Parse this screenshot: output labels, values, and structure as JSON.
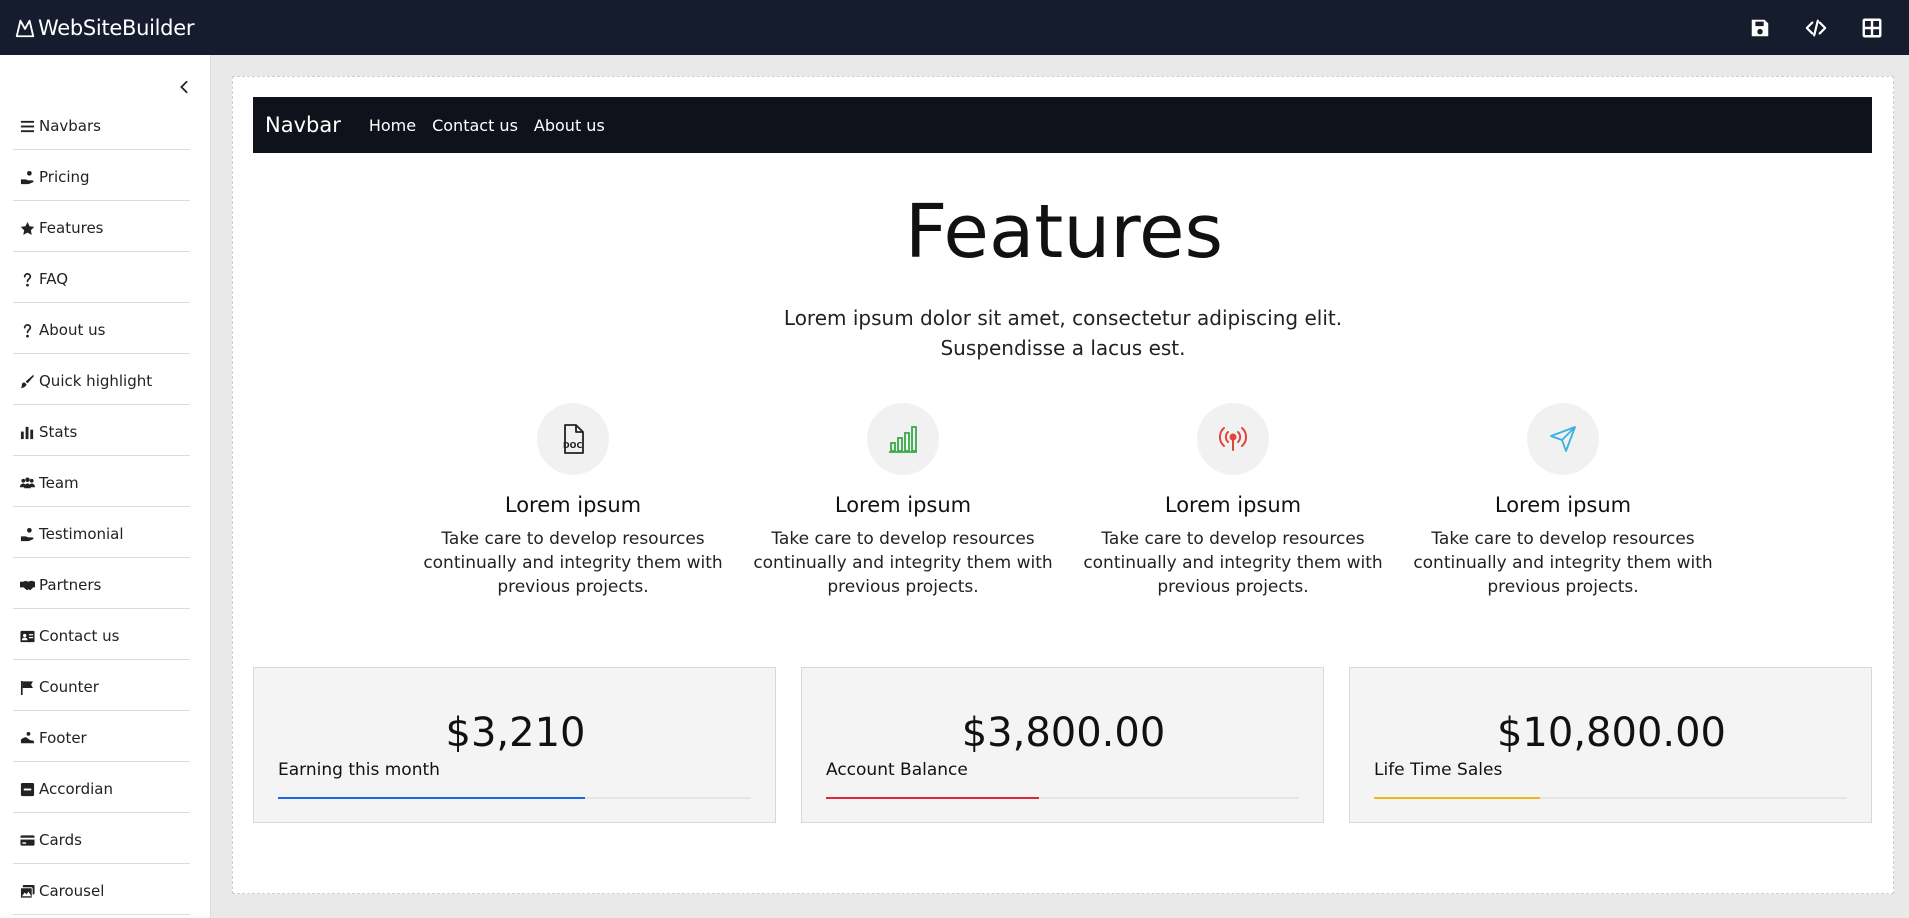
{
  "app": {
    "name": "WebSiteBuilder"
  },
  "toolbar": {
    "icons": [
      "save-icon",
      "code-icon",
      "grid-icon"
    ]
  },
  "sidebar": {
    "items": [
      {
        "label": "Navbars",
        "icon": "bars-icon"
      },
      {
        "label": "Pricing",
        "icon": "hand-coin-icon"
      },
      {
        "label": "Features",
        "icon": "star-icon"
      },
      {
        "label": "FAQ",
        "icon": "question-icon"
      },
      {
        "label": "About us",
        "icon": "question-icon"
      },
      {
        "label": "Quick highlight",
        "icon": "brush-icon"
      },
      {
        "label": "Stats",
        "icon": "bar-chart-icon"
      },
      {
        "label": "Team",
        "icon": "users-icon"
      },
      {
        "label": "Testimonial",
        "icon": "hand-coin-icon"
      },
      {
        "label": "Partners",
        "icon": "handshake-icon"
      },
      {
        "label": "Contact us",
        "icon": "id-card-icon"
      },
      {
        "label": "Counter",
        "icon": "flag-icon"
      },
      {
        "label": "Footer",
        "icon": "shoe-icon"
      },
      {
        "label": "Accordian",
        "icon": "minus-square-icon"
      },
      {
        "label": "Cards",
        "icon": "credit-card-icon"
      },
      {
        "label": "Carousel",
        "icon": "images-icon"
      }
    ]
  },
  "preview": {
    "navbar": {
      "brand": "Navbar",
      "links": [
        "Home",
        "Contact us",
        "About us"
      ]
    },
    "title": "Features",
    "lead_line1": "Lorem ipsum dolor sit amet, consectetur adipiscing elit.",
    "lead_line2": "Suspendisse a lacus est.",
    "features": [
      {
        "icon": "doc-file-icon",
        "color": "#222222",
        "title": "Lorem ipsum",
        "text": "Take care to develop resources continually and integrity them with previous projects."
      },
      {
        "icon": "bar-chart-icon",
        "color": "#3aa84a",
        "title": "Lorem ipsum",
        "text": "Take care to develop resources continually and integrity them with previous projects."
      },
      {
        "icon": "broadcast-icon",
        "color": "#e0453a",
        "title": "Lorem ipsum",
        "text": "Take care to develop resources continually and integrity them with previous projects."
      },
      {
        "icon": "send-icon",
        "color": "#3ab0e0",
        "title": "Lorem ipsum",
        "text": "Take care to develop resources continually and integrity them with previous projects."
      }
    ],
    "stats": [
      {
        "amount": "$3,210",
        "label": "Earning this month",
        "progress": 0.65,
        "color": "#1e66e6"
      },
      {
        "amount": "$3,800.00",
        "label": "Account Balance",
        "progress": 0.45,
        "color": "#e0263a"
      },
      {
        "amount": "$10,800.00",
        "label": "Life Time Sales",
        "progress": 0.35,
        "color": "#f2b51c"
      }
    ]
  }
}
